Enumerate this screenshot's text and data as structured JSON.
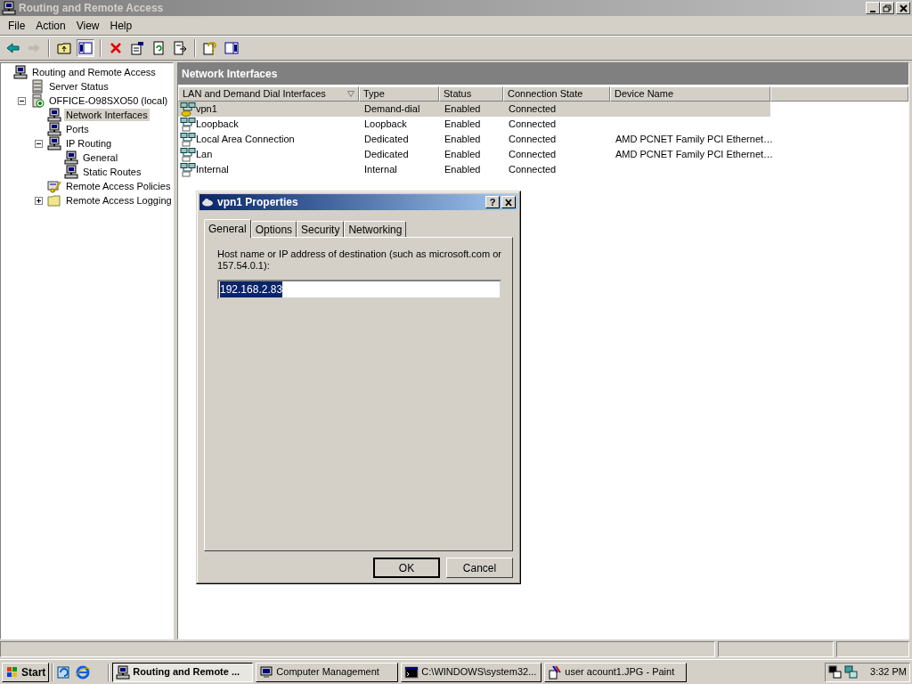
{
  "window": {
    "title": "Routing and Remote Access"
  },
  "menu": [
    "File",
    "Action",
    "View",
    "Help"
  ],
  "toolbar": [
    [
      {
        "kind": "back",
        "disabled": false
      },
      {
        "kind": "forward",
        "disabled": true
      }
    ],
    [
      {
        "kind": "up",
        "disabled": false
      },
      {
        "kind": "tree",
        "disabled": false
      }
    ],
    [
      {
        "kind": "delete",
        "disabled": false
      },
      {
        "kind": "properties",
        "disabled": false
      },
      {
        "kind": "refresh",
        "disabled": false
      },
      {
        "kind": "export",
        "disabled": false
      }
    ],
    [
      {
        "kind": "help",
        "disabled": false
      },
      {
        "kind": "pane",
        "disabled": false
      }
    ]
  ],
  "tree": [
    {
      "label": "Routing and Remote Access",
      "kind": "computer",
      "selected": false,
      "children": [
        {
          "label": "Server Status",
          "kind": "server",
          "selected": false
        },
        {
          "label": "OFFICE-O98SXO50 (local)",
          "kind": "local",
          "selected": false,
          "expanded": true,
          "children": [
            {
              "label": "Network Interfaces",
              "kind": "computer",
              "selected": true
            },
            {
              "label": "Ports",
              "kind": "computer",
              "selected": false
            },
            {
              "label": "IP Routing",
              "kind": "computer",
              "selected": false,
              "expanded": true,
              "children": [
                {
                  "label": "General",
                  "kind": "computer",
                  "selected": false
                },
                {
                  "label": "Static Routes",
                  "kind": "computer",
                  "selected": false
                }
              ]
            },
            {
              "label": "Remote Access Policies",
              "kind": "policy",
              "selected": false
            },
            {
              "label": "Remote Access Logging",
              "kind": "folder",
              "selected": false,
              "expanded": false
            }
          ]
        }
      ]
    }
  ],
  "pane": {
    "title": "Network Interfaces",
    "columns": [
      "LAN and Demand Dial Interfaces",
      "Type",
      "Status",
      "Connection State",
      "Device Name"
    ],
    "rows": [
      {
        "selected": true,
        "demand": true,
        "cells": [
          "vpn1",
          "Demand-dial",
          "Enabled",
          "Connected",
          ""
        ]
      },
      {
        "selected": false,
        "demand": false,
        "cells": [
          "Loopback",
          "Loopback",
          "Enabled",
          "Connected",
          ""
        ]
      },
      {
        "selected": false,
        "demand": false,
        "cells": [
          "Local Area Connection",
          "Dedicated",
          "Enabled",
          "Connected",
          "AMD PCNET Family PCI Ethernet…"
        ]
      },
      {
        "selected": false,
        "demand": false,
        "cells": [
          "Lan",
          "Dedicated",
          "Enabled",
          "Connected",
          "AMD PCNET Family PCI Ethernet…"
        ]
      },
      {
        "selected": false,
        "demand": false,
        "cells": [
          "Internal",
          "Internal",
          "Enabled",
          "Connected",
          ""
        ]
      }
    ]
  },
  "dialog": {
    "title": "vpn1 Properties",
    "help": "?",
    "tabs": [
      {
        "label": "General",
        "selected": true
      },
      {
        "label": "Options",
        "selected": false
      },
      {
        "label": "Security",
        "selected": false
      },
      {
        "label": "Networking",
        "selected": false
      }
    ],
    "label": "Host name or IP address of destination (such as microsoft.com or 157.54.0.1):",
    "value": "192.168.2.83",
    "buttons": [
      {
        "label": "OK",
        "default": true
      },
      {
        "label": "Cancel",
        "default": false
      }
    ]
  },
  "taskbar": {
    "start": "Start",
    "tasks": [
      {
        "label": "Routing and Remote ...",
        "kind": "computer",
        "selected": true
      },
      {
        "label": "Computer Management",
        "kind": "monitor",
        "selected": false
      },
      {
        "label": "C:\\WINDOWS\\system32...",
        "kind": "console",
        "selected": false
      },
      {
        "label": "user acount1.JPG - Paint",
        "kind": "paint",
        "selected": false
      }
    ],
    "clock": "3:32 PM"
  }
}
